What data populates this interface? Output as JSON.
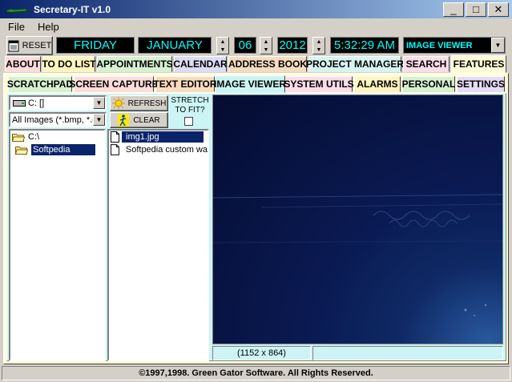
{
  "window": {
    "title": "Secretary-IT v1.0",
    "minimize_glyph": "_",
    "maximize_glyph": "□",
    "close_glyph": "✕"
  },
  "menu": {
    "items": [
      "File",
      "Help"
    ]
  },
  "statusrow": {
    "reset_label": "RESET",
    "day": "FRIDAY",
    "month": "JANUARY",
    "date": "06",
    "year": "2012",
    "time": "5:32:29 AM",
    "mode": "IMAGE VIEWER"
  },
  "main_tabs": [
    {
      "label": "ABOUT",
      "color": "#ffdcdc"
    },
    {
      "label": "TO DO LIST",
      "color": "#fff4c0"
    },
    {
      "label": "APPOINTMENTS",
      "color": "#d6f0d0"
    },
    {
      "label": "CALENDAR",
      "color": "#dcdcf4"
    },
    {
      "label": "ADDRESS BOOK",
      "color": "#f4dcc0"
    },
    {
      "label": "PROJECT MANAGER",
      "color": "#d8f4f0"
    },
    {
      "label": "SEARCH",
      "color": "#fcdce8"
    },
    {
      "label": "FEATURES",
      "color": "#fffcd8"
    }
  ],
  "sub_tabs": [
    {
      "label": "SCRATCHPAD",
      "color": "#d6f0d0"
    },
    {
      "label": "SCREEN CAPTURE",
      "color": "#fcdcdc"
    },
    {
      "label": "TEXT EDITOR",
      "color": "#f8dcc0"
    },
    {
      "label": "IMAGE VIEWER",
      "color": "#dcf8f8"
    },
    {
      "label": "SYSTEM UTILS",
      "color": "#fcdce8"
    },
    {
      "label": "ALARMS",
      "color": "#fff4c0"
    },
    {
      "label": "PERSONAL",
      "color": "#d6f0d0"
    },
    {
      "label": "SETTINGS",
      "color": "#e4dcf4"
    }
  ],
  "viewer": {
    "drive_value": "C: []",
    "filter_value": "All Images (*.bmp, *.g",
    "refresh_label": "REFRESH",
    "clear_label": "CLEAR",
    "stretch_label_line1": "STRETCH",
    "stretch_label_line2": "TO FIT?",
    "folders": [
      {
        "name": "C:\\",
        "selected": false
      },
      {
        "name": "Softpedia",
        "selected": true
      }
    ],
    "files": [
      {
        "name": "img1.jpg",
        "selected": true
      },
      {
        "name": "Softpedia custom wa",
        "selected": false
      }
    ],
    "image_size": "(1152 x 864)",
    "image_info": ""
  },
  "footer": {
    "copyright": "©1997,1998.  Green Gator Software.  All Rights Reserved."
  },
  "colors": {
    "lcd_text": "#00ffff",
    "selection": "#0a246a",
    "viewer_panel": "#ccf4f4"
  }
}
